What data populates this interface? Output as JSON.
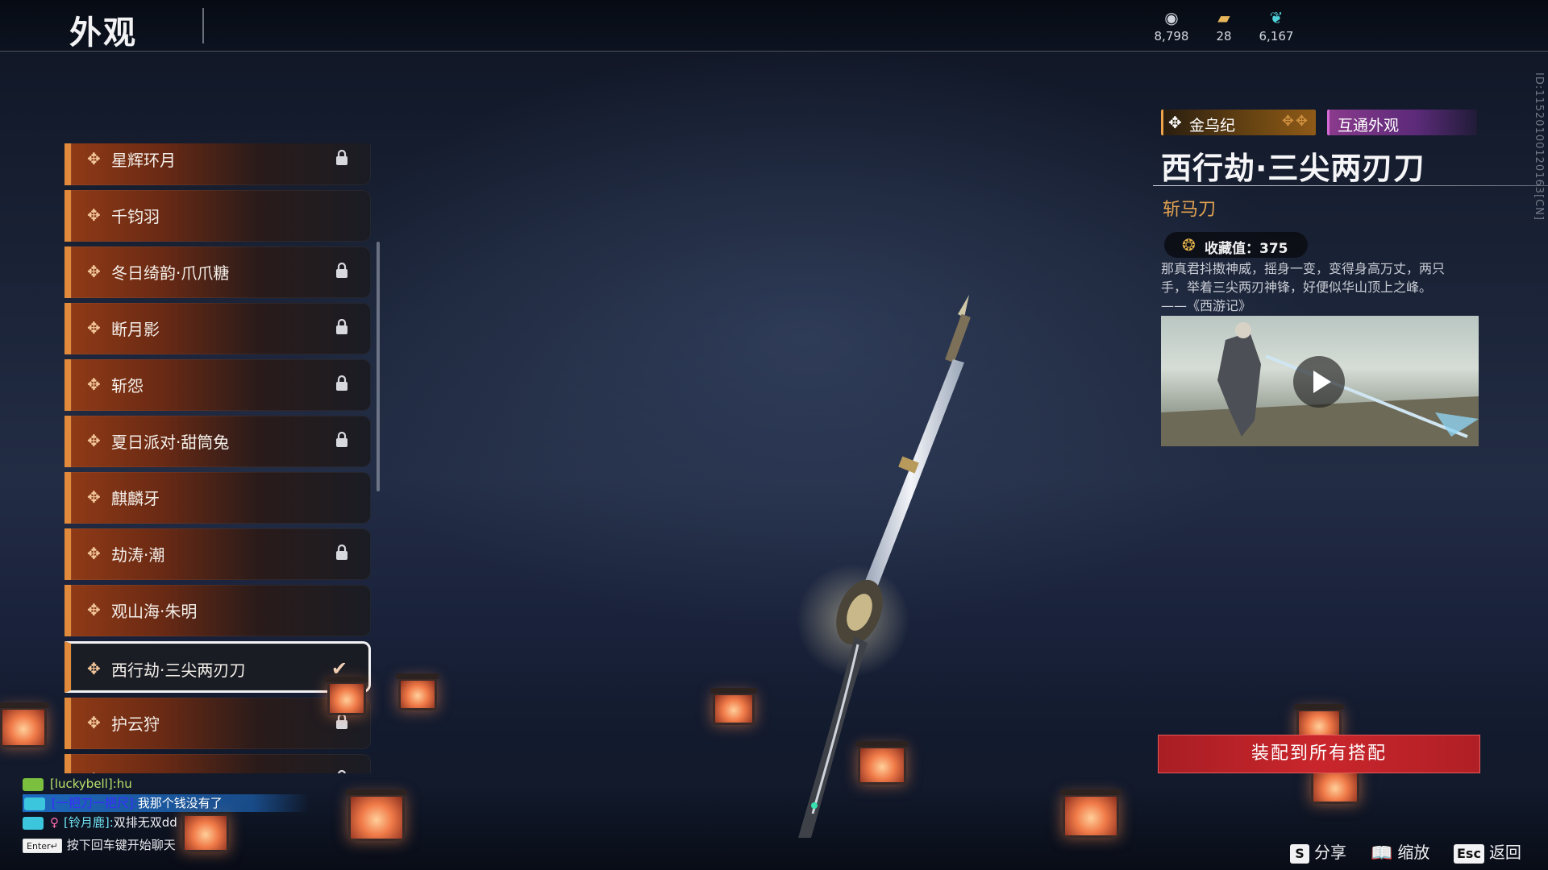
{
  "header": {
    "title": "外观",
    "currencies": [
      {
        "icon": "silver-coin-icon",
        "value": "8,798"
      },
      {
        "icon": "gold-ticket-icon",
        "value": "28"
      },
      {
        "icon": "feather-icon",
        "value": "6,167"
      }
    ]
  },
  "side_id": "ID:11520100120163[CN]",
  "skins": [
    {
      "label": "星辉环月",
      "locked": true,
      "selected": false
    },
    {
      "label": "千钧羽",
      "locked": false,
      "selected": false
    },
    {
      "label": "冬日绮韵·爪爪糖",
      "locked": true,
      "selected": false
    },
    {
      "label": "断月影",
      "locked": true,
      "selected": false
    },
    {
      "label": "斩怨",
      "locked": true,
      "selected": false
    },
    {
      "label": "夏日派对·甜筒兔",
      "locked": true,
      "selected": false
    },
    {
      "label": "麒麟牙",
      "locked": false,
      "selected": false
    },
    {
      "label": "劫涛·潮",
      "locked": true,
      "selected": false
    },
    {
      "label": "观山海·朱明",
      "locked": false,
      "selected": false
    },
    {
      "label": "西行劫·三尖两刃刀",
      "locked": false,
      "selected": true
    },
    {
      "label": "护云狩",
      "locked": true,
      "selected": false
    },
    {
      "label": "",
      "locked": true,
      "selected": false
    }
  ],
  "detail": {
    "series_tag": "金乌纪",
    "shared_tag": "互通外观",
    "name": "西行劫·三尖两刃刀",
    "weapon_type": "斩马刀",
    "collection_value": "收藏值：375",
    "quote_lines": [
      "那真君抖擞神威，摇身一变，变得身高万丈，两只",
      "手，举着三尖两刃神锋，好便似华山顶上之峰。"
    ],
    "quote_source": "——《西游记》"
  },
  "equip_button": "装配到所有搭配",
  "chat": {
    "line1": {
      "user": "[luckybell]:hu",
      "message": ""
    },
    "line2": {
      "user": "[一把刀一把尺]:",
      "message": "我那个钱没有了"
    },
    "line3": {
      "user": "[铃月鹿]:",
      "message": "双排无双dd"
    },
    "hint_key": "Enter↵",
    "hint_text": "按下回车键开始聊天"
  },
  "hotkeys": [
    {
      "key": "S",
      "label": "分享"
    },
    {
      "key": "",
      "label": "缩放"
    },
    {
      "key": "Esc",
      "label": "返回"
    }
  ],
  "colors": {
    "accent_orange": "#e28a3c",
    "equip_red": "#c9262c",
    "weapon_type": "#e3a250"
  }
}
